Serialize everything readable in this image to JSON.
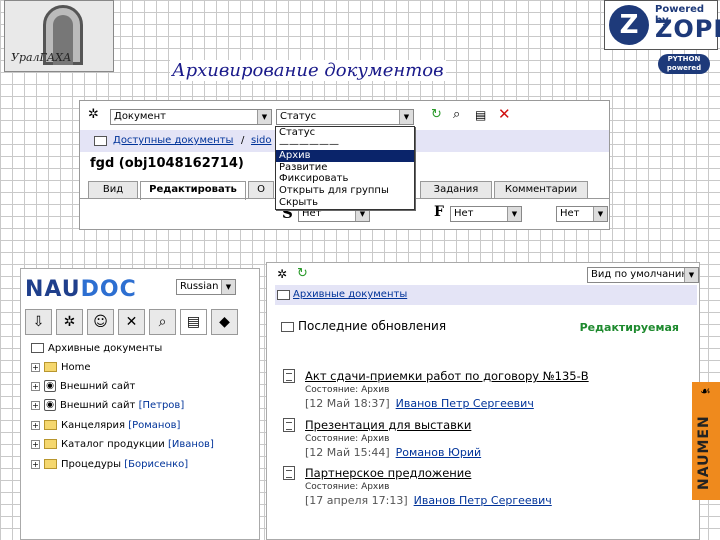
{
  "header": {
    "logo_text": "УралГАХА",
    "page_title": "Архивирование документов",
    "zope_powered": "Powered by",
    "zope_word": "ZOPE",
    "python_badge": "PYTHON powered"
  },
  "top_panel": {
    "type_select": "Документ",
    "status_select": "Статус",
    "breadcrumb": [
      "Доступные документы",
      "sido"
    ],
    "object_title": "fgd (obj1048162714)",
    "tabs": [
      "Вид",
      "Редактировать",
      "О",
      "Задания",
      "Комментарии"
    ],
    "active_tab": "Редактировать",
    "format_select_1": "Нет",
    "format_select_2": "Нет",
    "format_F": "F",
    "dropdown": [
      "Статус",
      "——————",
      "Архив",
      "Развитие",
      "Фиксировать",
      "Открыть для группы",
      "Скрыть"
    ],
    "dropdown_highlighted": "Архив"
  },
  "left_panel": {
    "brand": "NAUDOC",
    "language": "Russian",
    "tree_root": "Архивные документы",
    "tree_items": [
      {
        "label": "Home",
        "owner": ""
      },
      {
        "label": "Внешний сайт",
        "owner": ""
      },
      {
        "label": "Внешний сайт",
        "owner": "[Петров]"
      },
      {
        "label": "Канцелярия",
        "owner": "[Романов]"
      },
      {
        "label": "Каталог продукции",
        "owner": "[Иванов]"
      },
      {
        "label": "Процедуры",
        "owner": "[Борисенко]"
      }
    ]
  },
  "right_panel": {
    "view_select": "Вид по умолчанию",
    "breadcrumb": "Архивные документы",
    "recent_title": "Последние обновления",
    "editable_label": "Редактируемая",
    "documents": [
      {
        "title": "Акт сдачи-приемки работ по договору №135-В",
        "state": "Состояние:  Архив",
        "date": "[12 Май 18:37]",
        "author": "Иванов Петр Сергеевич"
      },
      {
        "title": "Презентация для выставки",
        "state": "Состояние:  Архив",
        "date": "[12 Май 15:44]",
        "author": "Романов Юрий"
      },
      {
        "title": "Партнерское предложение",
        "state": "Состояние:  Архив",
        "date": "[17 апреля 17:13]",
        "author": "Иванов Петр Сергеевич"
      }
    ]
  },
  "side_brand": "NAUMEN",
  "colors": {
    "accent_blue": "#1e3a7a",
    "link": "#003399",
    "editable_green": "#1e8a2e",
    "naumen_orange": "#ef8a1d",
    "breadcrumb_bg": "#e4e4f6"
  }
}
